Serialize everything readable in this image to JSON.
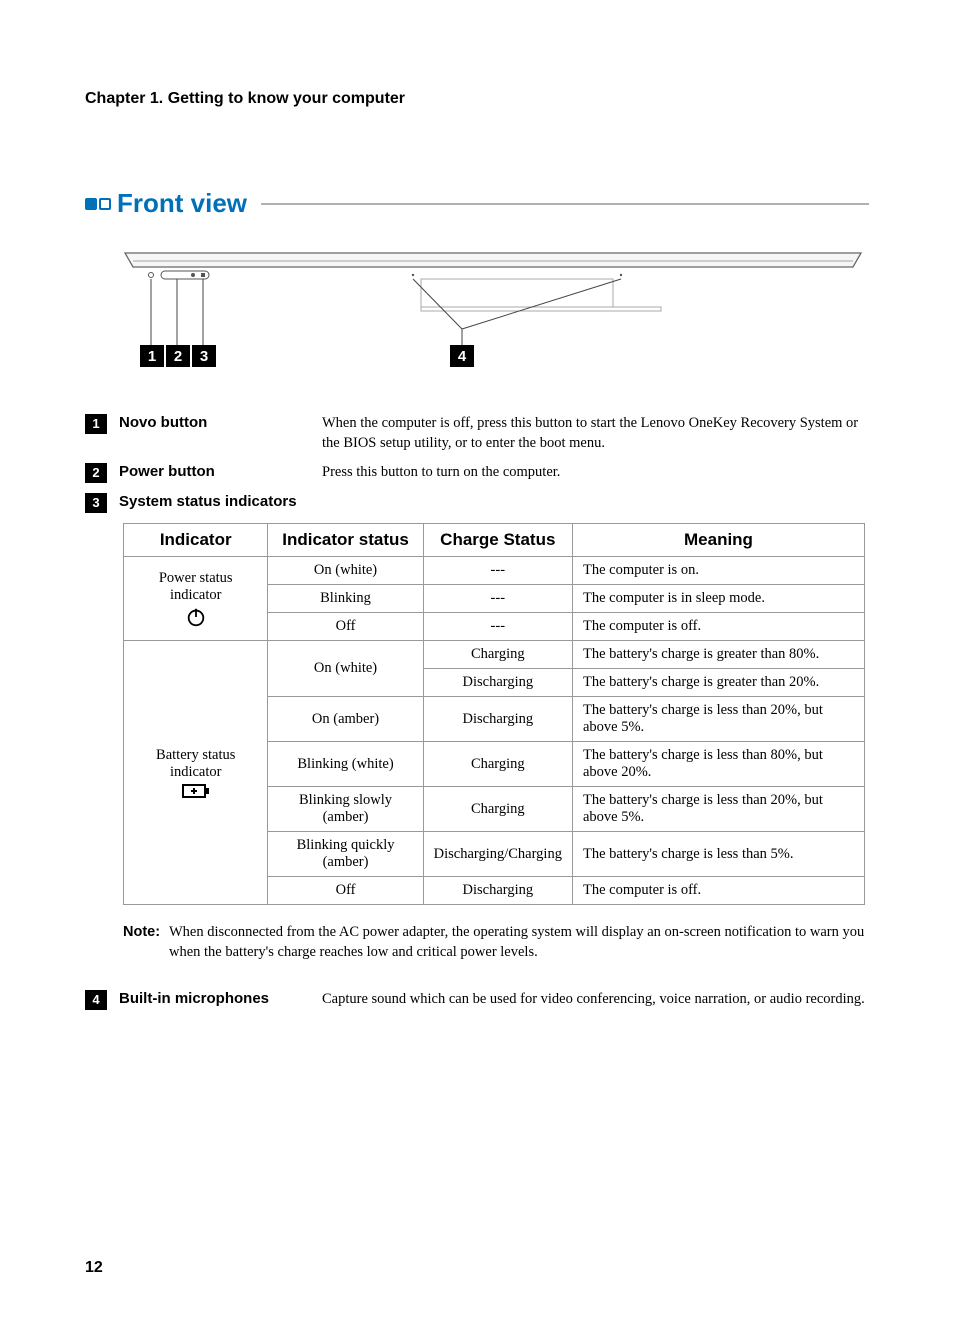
{
  "chapter": "Chapter 1. Getting to know your computer",
  "section": "Front view",
  "items": [
    {
      "num": "1",
      "label": "Novo button",
      "desc": "When the computer is off, press this button to start the Lenovo OneKey Recovery System or the BIOS setup utility, or to enter the boot menu."
    },
    {
      "num": "2",
      "label": "Power button",
      "desc": "Press this button to turn on the computer."
    },
    {
      "num": "3",
      "label": "System status indicators",
      "desc": ""
    },
    {
      "num": "4",
      "label": "Built-in microphones",
      "desc": "Capture sound which can be used for video conferencing, voice narration, or audio recording."
    }
  ],
  "table": {
    "headers": {
      "indicator": "Indicator",
      "indicator_status": "Indicator status",
      "charge_status": "Charge Status",
      "meaning": "Meaning"
    },
    "power_label": "Power status indicator",
    "battery_label": "Battery status indicator",
    "rows": [
      {
        "ind_status": "On (white)",
        "charge": "---",
        "meaning": "The computer is on."
      },
      {
        "ind_status": "Blinking",
        "charge": "---",
        "meaning": "The computer is in sleep mode."
      },
      {
        "ind_status": "Off",
        "charge": "---",
        "meaning": "The computer is off."
      },
      {
        "ind_status": "On (white)",
        "charge": "Charging",
        "meaning": "The battery's charge is greater than 80%."
      },
      {
        "ind_status": "On (white)",
        "charge": "Discharging",
        "meaning": "The battery's charge is greater than 20%."
      },
      {
        "ind_status": "On (amber)",
        "charge": "Discharging",
        "meaning": "The battery's charge is less than 20%, but above 5%."
      },
      {
        "ind_status": "Blinking (white)",
        "charge": "Charging",
        "meaning": "The battery's charge is less than 80%, but above 20%."
      },
      {
        "ind_status": "Blinking slowly (amber)",
        "charge": "Charging",
        "meaning": "The battery's charge is less than 20%, but above 5%."
      },
      {
        "ind_status": "Blinking quickly (amber)",
        "charge": "Discharging/Charging",
        "meaning": "The battery's charge is less than 5%."
      },
      {
        "ind_status": "Off",
        "charge": "Discharging",
        "meaning": "The computer is off."
      }
    ]
  },
  "note": {
    "label": "Note:",
    "text": "When disconnected from the AC power adapter, the operating system will display an on-screen notification to warn you when the battery's charge reaches low and critical power levels."
  },
  "page_number": "12"
}
